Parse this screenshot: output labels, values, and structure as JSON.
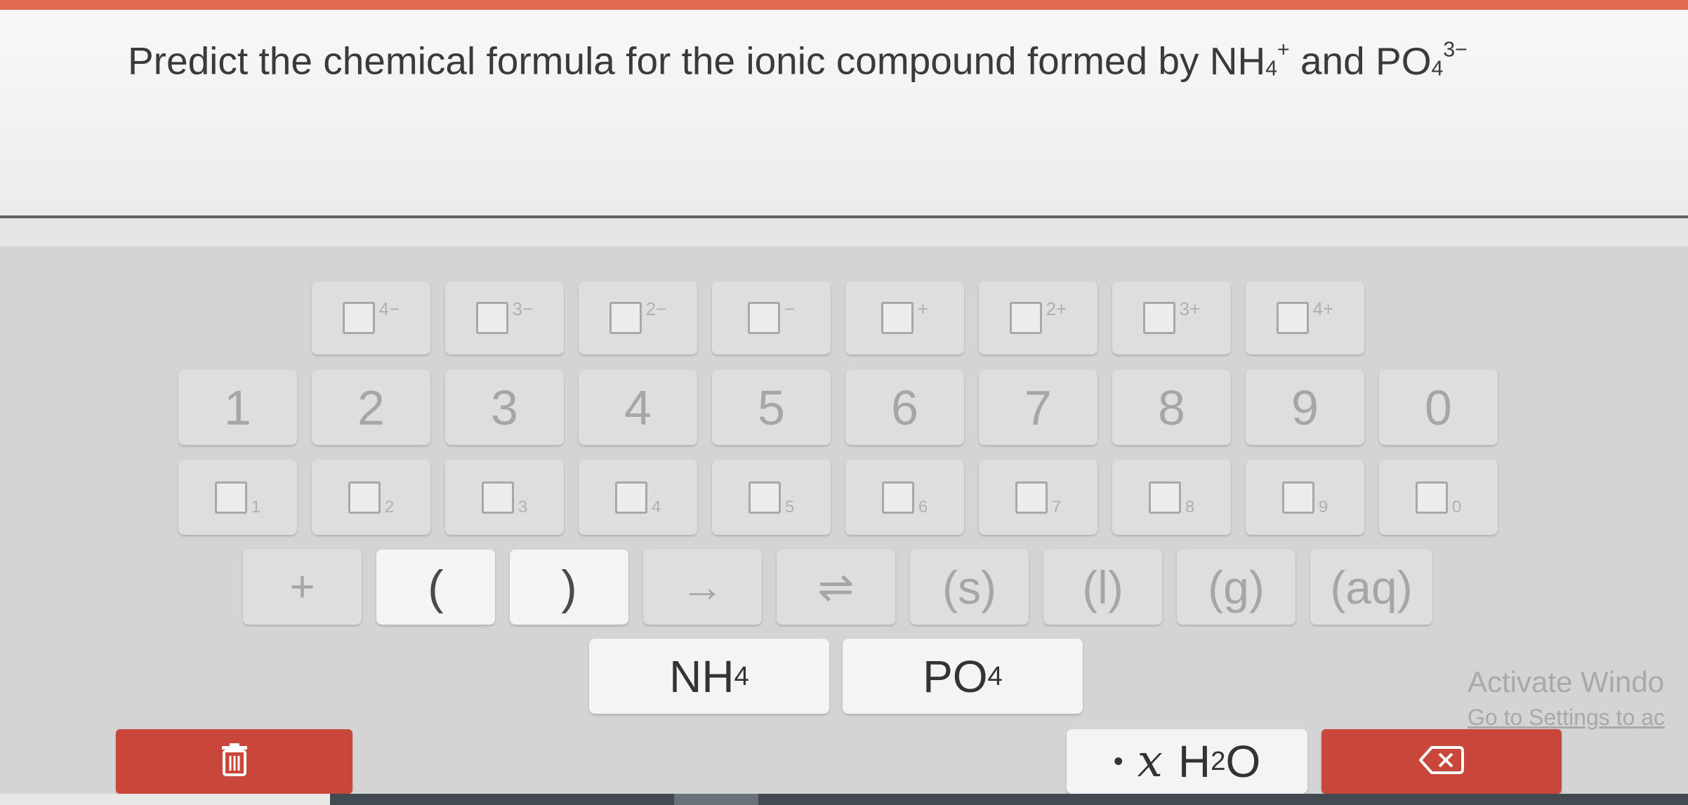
{
  "question": {
    "text": "Predict the chemical formula for the ionic compound formed by",
    "cation_base": "NH",
    "cation_sub": "4",
    "cation_charge": "+",
    "conjunction": "and",
    "anion_base": "PO",
    "anion_sub": "4",
    "anion_charge": "3−"
  },
  "keypad": {
    "charges": [
      "4−",
      "3−",
      "2−",
      "−",
      "+",
      "2+",
      "3+",
      "4+"
    ],
    "digits": [
      "1",
      "2",
      "3",
      "4",
      "5",
      "6",
      "7",
      "8",
      "9",
      "0"
    ],
    "subscripts": [
      "1",
      "2",
      "3",
      "4",
      "5",
      "6",
      "7",
      "8",
      "9",
      "0"
    ],
    "symbols": {
      "plus": "+",
      "open_paren": "(",
      "close_paren": ")",
      "arrow": "→",
      "equilibrium": "⇌",
      "solid": "(s)",
      "liquid": "(l)",
      "gas": "(g)",
      "aqueous": "(aq)"
    },
    "ions": [
      {
        "base": "NH",
        "sub": "4"
      },
      {
        "base": "PO",
        "sub": "4"
      }
    ],
    "hydrate": {
      "dot": "•",
      "x": "x",
      "h": "H",
      "sub": "2",
      "o": "O"
    },
    "delete_icon": "trash-icon",
    "backspace_icon": "backspace-icon"
  },
  "watermark": {
    "line1": "Activate Windo",
    "line2": "Go to Settings to ac"
  },
  "colors": {
    "top_bar": "#df6a50",
    "red_button": "#c9463b",
    "keypad_bg": "#d4d4d4"
  }
}
